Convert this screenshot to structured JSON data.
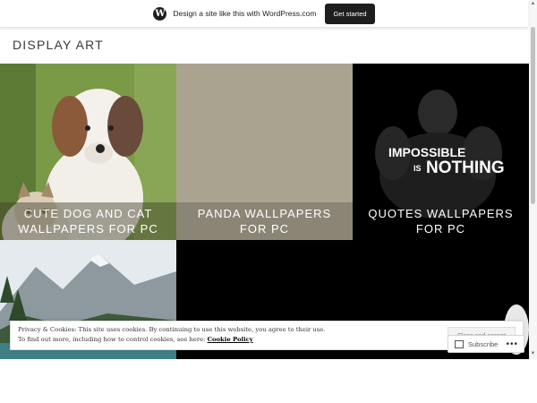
{
  "banner": {
    "text": "Design a site like this with WordPress.com",
    "button": "Get started",
    "logo_icon": "wordpress-logo-icon",
    "logo_glyph": "W"
  },
  "site": {
    "title": "DISPLAY ART"
  },
  "tiles": [
    {
      "caption_line1": "CUTE DOG AND CAT",
      "caption_line2": "WALLPAPERS FOR PC"
    },
    {
      "caption_line1": "PANDA WALLPAPERS",
      "caption_line2": "FOR PC"
    },
    {
      "caption_line1": "QUOTES WALLPAPERS",
      "caption_line2": "FOR PC",
      "image_text1": "IMPOSSIBLE",
      "image_text2": "IS",
      "image_text3": "NOTHING"
    }
  ],
  "cookie": {
    "line1": "Privacy & Cookies: This site uses cookies. By continuing to use this website, you agree to their use.",
    "line2_prefix": "To find out more, including how to control cookies, see here:",
    "policy_link": "Cookie Policy",
    "button": "Close and accept"
  },
  "subscribe": {
    "label": "Subscribe",
    "more": "•••"
  },
  "colors": {
    "banner_button_bg": "#1e1e1e",
    "grid_bg": "#000000"
  }
}
